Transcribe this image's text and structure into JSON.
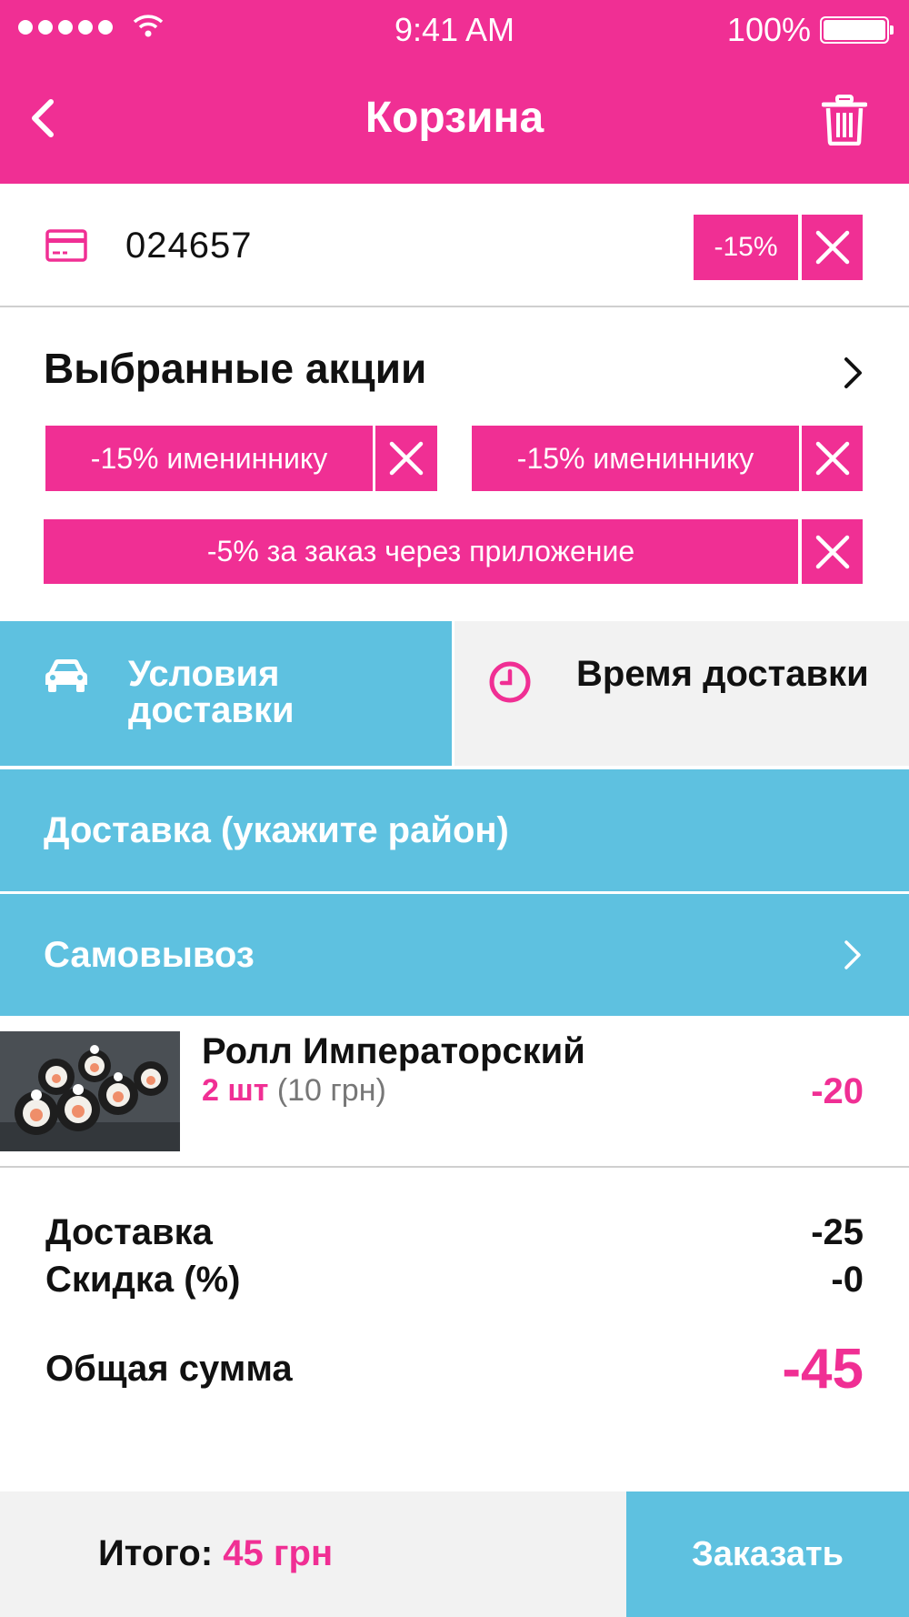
{
  "colors": {
    "accent": "#F02F94",
    "secondary": "#5EC1E0",
    "tab_inactive_bg": "#F2F2F2"
  },
  "status_bar": {
    "time": "9:41 AM",
    "battery": "100%",
    "signal_icon": "signal-dots-icon",
    "wifi_icon": "wifi-icon",
    "battery_icon": "battery-icon"
  },
  "header": {
    "title": "Корзина",
    "back_icon": "chevron-left-icon",
    "trash_icon": "trash-icon"
  },
  "promo_code": {
    "icon": "credit-card-icon",
    "code": "024657",
    "discount": "-15%"
  },
  "promotions": {
    "title": "Выбранные акции",
    "items": [
      {
        "label": "-15% имениннику"
      },
      {
        "label": "-15% имениннику"
      },
      {
        "label": "-5% за заказ через приложение"
      }
    ]
  },
  "delivery_tabs": [
    {
      "label": "Условия доставки",
      "icon": "car-icon",
      "active": true
    },
    {
      "label": "Время доставки",
      "icon": "clock-icon",
      "active": false
    }
  ],
  "delivery_options": [
    {
      "label": "Доставка (укажите район)"
    },
    {
      "label": "Самовывоз"
    }
  ],
  "cart_item": {
    "name": "Ролл Императорский",
    "qty": "2 шт",
    "unit_price": "(10 грн)",
    "total": "-20"
  },
  "summary": {
    "delivery_label": "Доставка",
    "delivery_value": "-25",
    "discount_label": "Скидка (%)",
    "discount_value": "-0",
    "grand_label": "Общая сумма",
    "grand_value": "-45"
  },
  "footer": {
    "total_label": "Итого:",
    "total_value": "45 грн",
    "order_button": "Заказать"
  }
}
